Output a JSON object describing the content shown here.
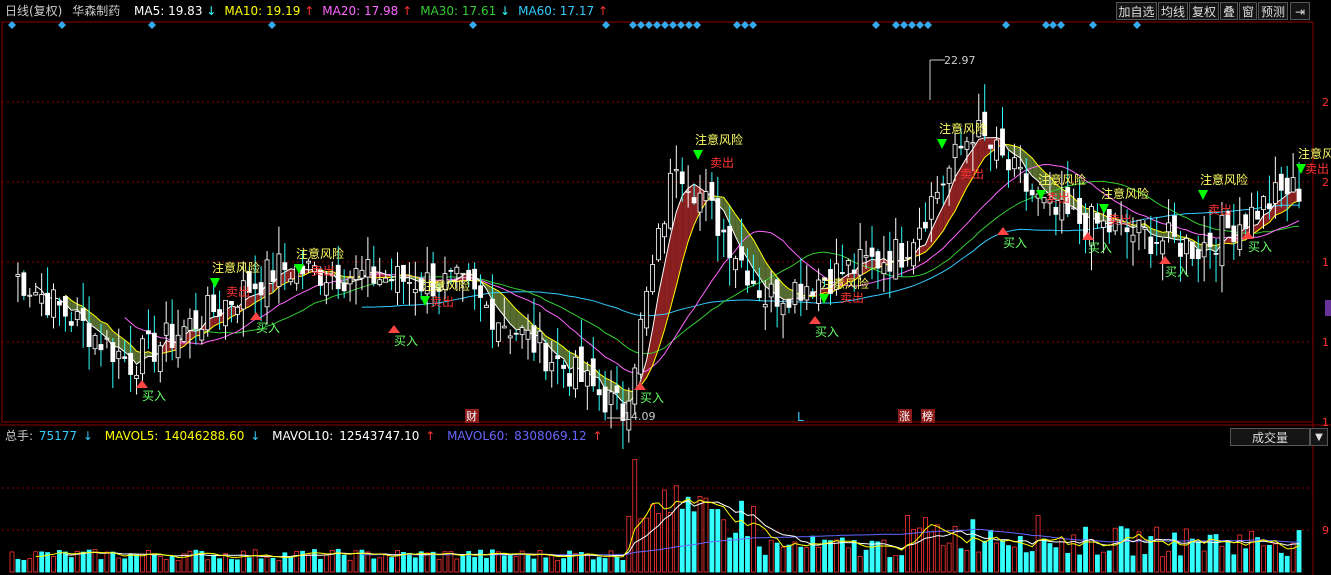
{
  "header": {
    "period": "日线(复权)",
    "stock_name": "华森制药",
    "ma": [
      {
        "label": "MA5:",
        "value": "19.83",
        "dir": "down",
        "color": "#ffffff"
      },
      {
        "label": "MA10:",
        "value": "19.19",
        "dir": "up",
        "color": "#ffff00"
      },
      {
        "label": "MA20:",
        "value": "17.98",
        "dir": "up",
        "color": "#ff66ff"
      },
      {
        "label": "MA30:",
        "value": "17.61",
        "dir": "down",
        "color": "#33cc33"
      },
      {
        "label": "MA60:",
        "value": "17.17",
        "dir": "up",
        "color": "#33ccff"
      }
    ]
  },
  "toolbar": {
    "add_watch": "加自选",
    "avg_line": "均线",
    "restore_rights": "复权",
    "overlay": "叠",
    "window": "窗",
    "forecast": "预测"
  },
  "volume_header": {
    "total_label": "总手:",
    "total_value": "75177",
    "total_dir": "down",
    "mavol5_label": "MAVOL5:",
    "mavol5_value": "14046288.60",
    "mavol5_dir": "down",
    "mavol10_label": "MAVOL10:",
    "mavol10_value": "12543747.10",
    "mavol10_dir": "up",
    "mavol60_label": "MAVOL60:",
    "mavol60_value": "8308069.12",
    "mavol60_dir": "up",
    "indicator_select": "成交量"
  },
  "annotations": {
    "high_price": "22.97",
    "low_price": "14.09",
    "risk_label": "注意风险",
    "sell_label": "卖出",
    "buy_label": "买入",
    "event_finance": "财",
    "event_l": "L",
    "event_zhang": "涨",
    "event_bang": "榜"
  },
  "axis": {
    "right_partial_labels": [
      "2",
      "2",
      "1",
      "1",
      "1"
    ],
    "vol_right_labels": [
      "2",
      "9"
    ]
  },
  "colors": {
    "up": "#ff3333",
    "down": "#33ffff",
    "ma5": "#ffffff",
    "ma10": "#ffff00",
    "ma20": "#ff66ff",
    "ma30": "#33cc33",
    "ma60": "#33ccff",
    "band_up": "#8b2020",
    "band_down": "#556b2f",
    "grid": "#8b0000",
    "diamond": "#33aaee",
    "risk_text": "#ffff66",
    "sell_text": "#ff3333",
    "buy_text": "#66ff66"
  },
  "chart_data": {
    "type": "candlestick",
    "title": "华森制药 日线(复权)",
    "high_mark": 22.97,
    "low_mark": 14.09,
    "key_points": [
      {
        "idx": 0,
        "close": 17.5
      },
      {
        "idx": 20,
        "close": 15.3
      },
      {
        "idx": 45,
        "close": 17.6
      },
      {
        "idx": 75,
        "close": 17.2
      },
      {
        "idx": 103,
        "close": 14.1
      },
      {
        "idx": 112,
        "close": 20.3
      },
      {
        "idx": 127,
        "close": 16.9
      },
      {
        "idx": 150,
        "close": 18.0
      },
      {
        "idx": 162,
        "close": 21.0
      },
      {
        "idx": 175,
        "close": 18.9
      },
      {
        "idx": 200,
        "close": 18.1
      },
      {
        "idx": 215,
        "close": 19.5
      }
    ],
    "volume_series": [
      "总手",
      "MAVOL5",
      "MAVOL10",
      "MAVOL60"
    ]
  }
}
